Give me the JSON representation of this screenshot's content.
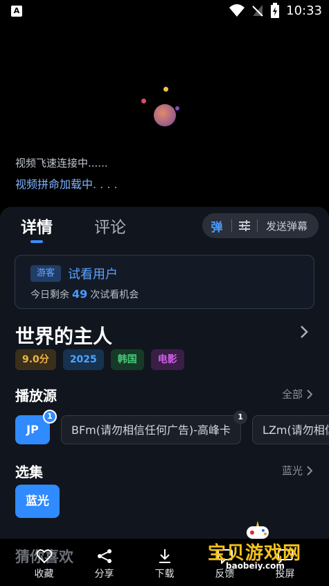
{
  "status_bar": {
    "notification_icon": "A",
    "time": "10:33"
  },
  "player": {
    "loading_line1": "视频飞速连接中......",
    "loading_line2": "视频拼命加载中. . . ."
  },
  "tabs": [
    {
      "label": "详情",
      "active": true
    },
    {
      "label": "评论",
      "active": false
    }
  ],
  "danmu": {
    "toggle_label": "弹",
    "send_label": "发送弹幕"
  },
  "trial": {
    "badge": "游客",
    "user_type": "试看用户",
    "remain_prefix": "今日剩余",
    "remain_count": "49",
    "remain_suffix": "次试看机会"
  },
  "movie": {
    "title": "世界的主人",
    "tags": {
      "score": "9.0分",
      "year": "2025",
      "region": "韩国",
      "genre": "电影"
    }
  },
  "sources_section": {
    "title": "播放源",
    "more_label": "全部",
    "items": [
      {
        "label": "JP",
        "badge": "1",
        "active": true
      },
      {
        "label": "BFm(请勿相信任何广告)-高峰卡",
        "badge": "1",
        "active": false
      },
      {
        "label": "LZm(请勿相信任何广告)",
        "badge": "",
        "active": false
      }
    ]
  },
  "episodes_section": {
    "title": "选集",
    "more_label": "蓝光",
    "items": [
      {
        "label": "蓝光",
        "active": true
      }
    ]
  },
  "guess_title": "猜你喜欢",
  "actions": [
    {
      "label": "收藏",
      "icon": "heart-icon"
    },
    {
      "label": "分享",
      "icon": "share-icon"
    },
    {
      "label": "下载",
      "icon": "download-icon"
    },
    {
      "label": "反馈",
      "icon": "feedback-icon"
    },
    {
      "label": "投屏",
      "icon": "cast-icon"
    }
  ],
  "watermark": {
    "text": "宝贝游戏网",
    "url": "baobeiy.com"
  },
  "colors": {
    "accent": "#2f8bff",
    "panel": "#11151d",
    "score": "#f0b448",
    "region": "#48c67a",
    "genre": "#d060ea"
  }
}
